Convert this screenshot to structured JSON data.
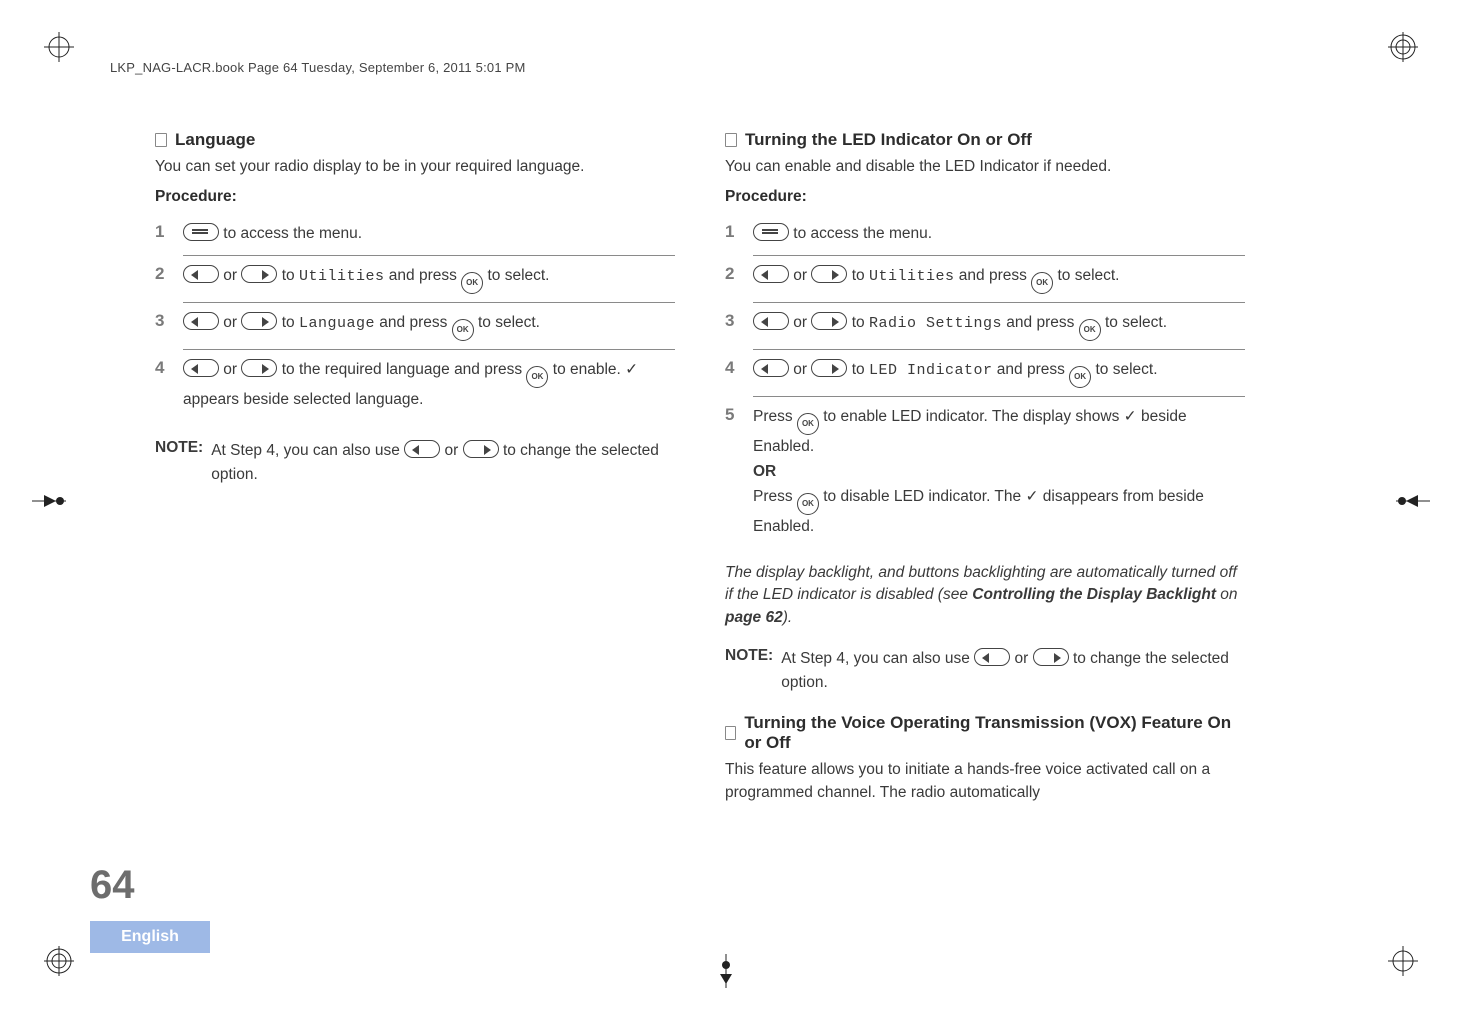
{
  "header": "LKP_NAG-LACR.book  Page 64  Tuesday, September 6, 2011  5:01 PM",
  "page_number": "64",
  "page_language": "English",
  "left": {
    "title": "Language",
    "intro": "You can set your radio display to be in your required language.",
    "procedure_label": "Procedure:",
    "steps": {
      "s1_a": " to access the menu.",
      "s2_a": " or  ",
      "s2_b": " to ",
      "s2_mono": "Utilities",
      "s2_c": " and press ",
      "s2_d": " to select.",
      "s3_a": " or  ",
      "s3_b": " to ",
      "s3_mono": "Language",
      "s3_c": " and press ",
      "s3_d": " to select.",
      "s4_a": " or  ",
      "s4_b": " to the required language and press ",
      "s4_c": " to enable. ",
      "s4_check": "✓",
      "s4_d": " appears beside selected language."
    },
    "note_label": "NOTE:",
    "note_a": "At Step 4, you can also use ",
    "note_b": " or  ",
    "note_c": " to change the selected option."
  },
  "right": {
    "title1": "Turning the LED Indicator On or Off",
    "intro1": "You can enable and disable the LED Indicator if needed.",
    "procedure_label": "Procedure:",
    "steps": {
      "s1_a": " to access the menu.",
      "s2_a": " or  ",
      "s2_b": " to ",
      "s2_mono": "Utilities",
      "s2_c": " and press ",
      "s2_d": " to select.",
      "s3_a": " or  ",
      "s3_b": " to ",
      "s3_mono": "Radio Settings",
      "s3_c": " and press ",
      "s3_d": " to select.",
      "s4_a": " or  ",
      "s4_b": " to ",
      "s4_mono": "LED Indicator",
      "s4_c": " and press ",
      "s4_d": " to select.",
      "s5_a": "Press ",
      "s5_b": " to enable LED indicator. The display shows ",
      "s5_check": "✓",
      "s5_c": " beside Enabled.",
      "s5_or": "OR",
      "s5_d": "Press ",
      "s5_e": " to disable LED indicator. The ",
      "s5_check2": "✓",
      "s5_f": " disappears from beside Enabled."
    },
    "italic_a": "The display backlight, and buttons backlighting are automatically turned off if the LED indicator is disabled (see ",
    "italic_bold": "Controlling the Display Backlight",
    "italic_b": " on ",
    "italic_bold2": "page 62",
    "italic_c": ").",
    "note_label": "NOTE:",
    "note_a": "At Step 4, you can also use ",
    "note_b": " or  ",
    "note_c": " to change the selected option.",
    "title2": "Turning the Voice Operating Transmission (VOX) Feature On or Off",
    "intro2": "This feature allows you to initiate a hands-free voice activated call on a programmed channel. The radio automatically"
  },
  "step_numbers": {
    "n1": "1",
    "n2": "2",
    "n3": "3",
    "n4": "4",
    "n5": "5"
  }
}
